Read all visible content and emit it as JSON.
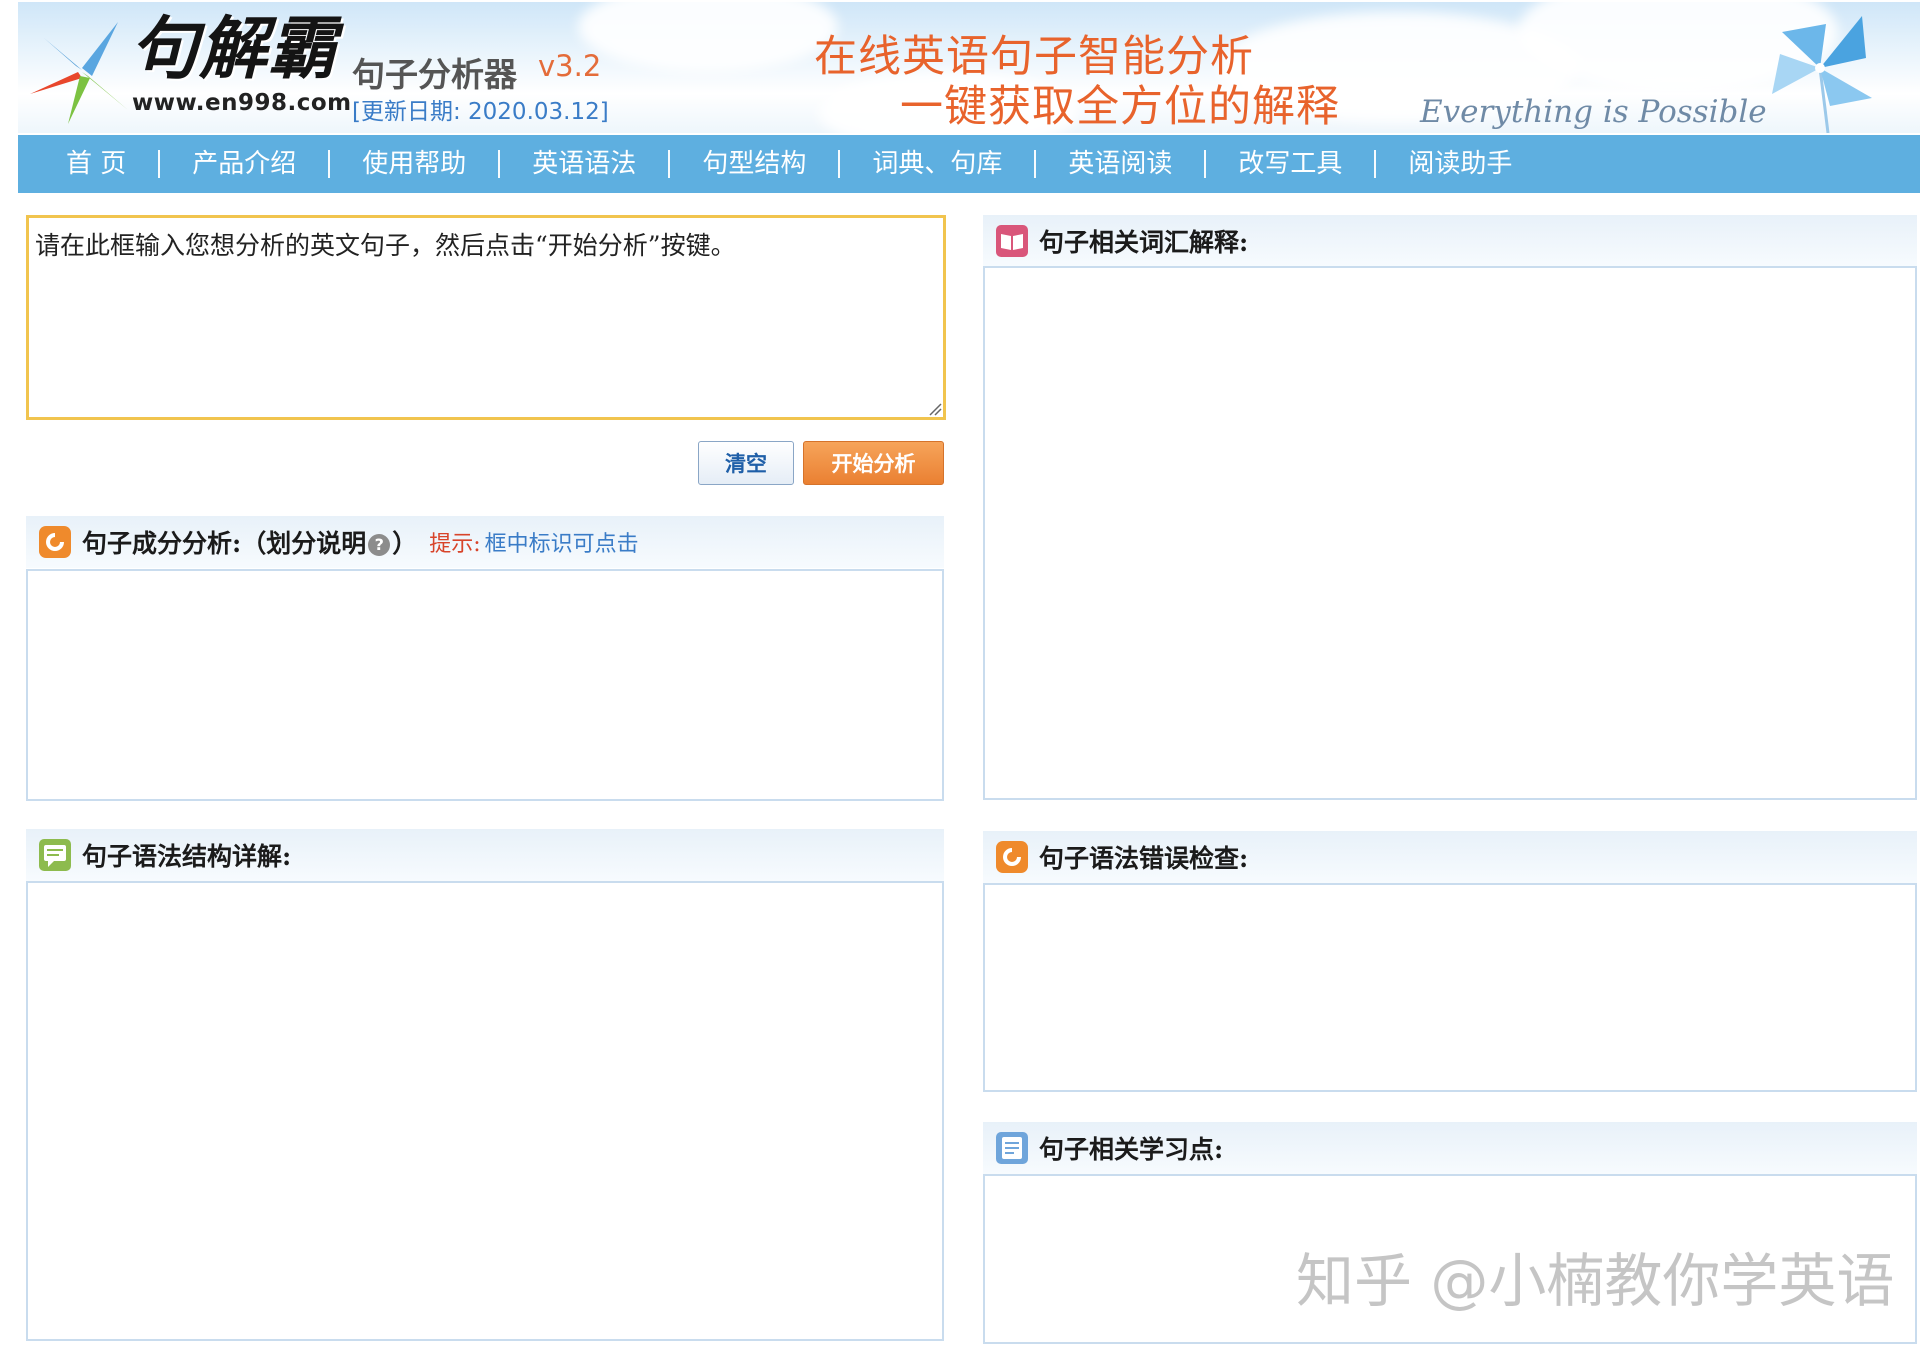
{
  "header": {
    "brand_name": "句解霸",
    "brand_url": "www.en998.com",
    "product_name": "句子分析器",
    "product_version": "v3.2",
    "update_date": "[更新日期: 2020.03.12]",
    "slogan_line1": "在线英语句子智能分析",
    "slogan_line2": "一键获取全方位的解释",
    "motto": "Everything is Possible"
  },
  "nav": {
    "items": [
      "首 页",
      "产品介绍",
      "使用帮助",
      "英语语法",
      "句型结构",
      "词典、句库",
      "英语阅读",
      "改写工具",
      "阅读助手"
    ]
  },
  "input": {
    "placeholder": "请在此框输入您想分析的英文句子，然后点击“开始分析”按键。",
    "value": ""
  },
  "buttons": {
    "clear": "清空",
    "analyze": "开始分析"
  },
  "panels": {
    "components": {
      "title": "句子成分分析:（划分说明",
      "title_end": "）",
      "help_icon": "?",
      "tip_label": "提示:",
      "tip_text": "框中标识可点击"
    },
    "grammar_structure": {
      "title": "句子语法结构详解:"
    },
    "vocabulary": {
      "title": "句子相关词汇解释:"
    },
    "error_check": {
      "title": "句子语法错误检查:"
    },
    "learning_points": {
      "title": "句子相关学习点:"
    }
  },
  "icons": {
    "logo": "star-burst-logo-icon",
    "pinwheel": "pinwheel-icon",
    "components": "orange-bubble-icon",
    "grammar_structure": "green-chat-icon",
    "vocabulary": "pink-book-icon",
    "error_check": "orange-bubble-icon",
    "learning_points": "blue-document-icon"
  },
  "colors": {
    "nav_bg": "#5eafe0",
    "accent_orange": "#ea8032",
    "input_border": "#f1c44e",
    "panel_border": "#c9dcee",
    "link_blue": "#3a7cc7",
    "tip_red": "#d8442a"
  },
  "watermark": "知乎 @小楠教你学英语"
}
